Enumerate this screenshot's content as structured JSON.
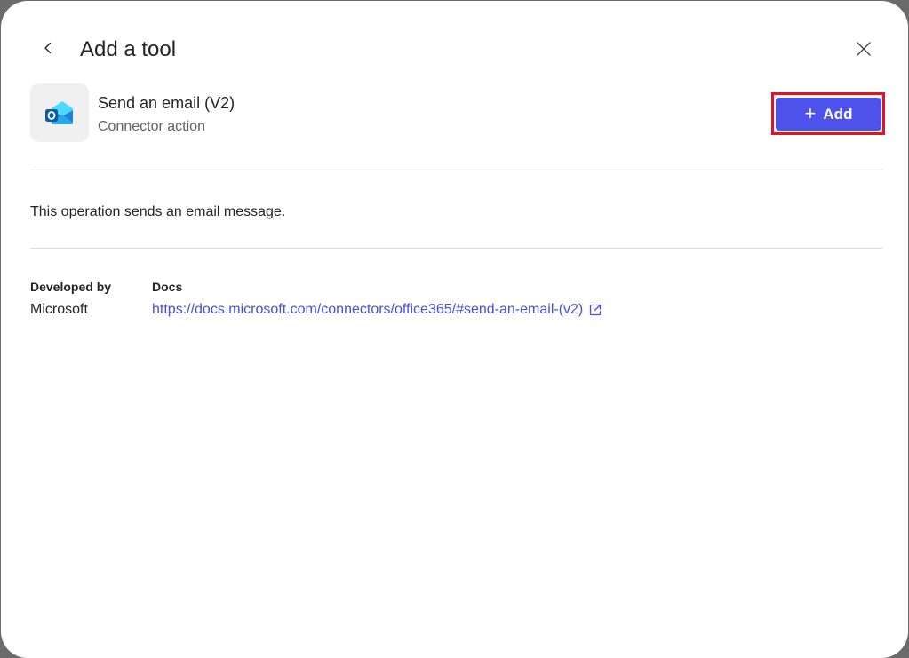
{
  "dialog": {
    "title": "Add a tool"
  },
  "tool": {
    "name": "Send an email (V2)",
    "type": "Connector action",
    "icon": "outlook-icon",
    "add_label": "Add"
  },
  "description": "This operation sends an email message.",
  "meta": {
    "developed_by_label": "Developed by",
    "developed_by_value": "Microsoft",
    "docs_label": "Docs",
    "docs_url": "https://docs.microsoft.com/connectors/office365/#send-an-email-(v2)"
  },
  "colors": {
    "accent": "#4f52ea",
    "link": "#4a4fd9",
    "highlight": "#e81123"
  }
}
